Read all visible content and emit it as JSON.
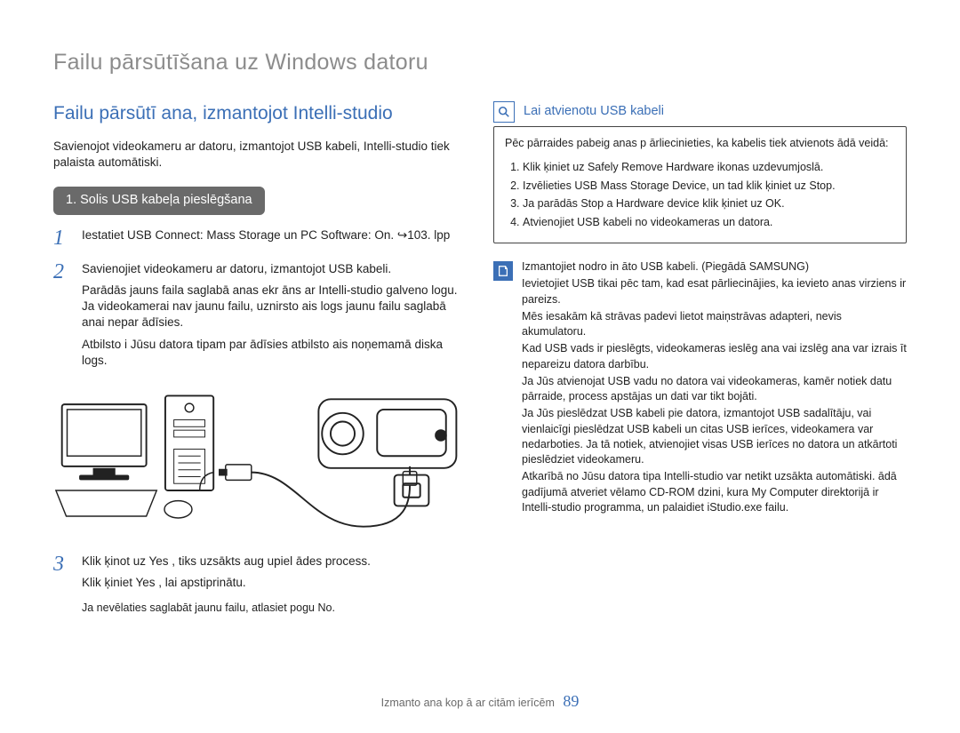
{
  "page_header": "Failu pārsūtīšana uz Windows datoru",
  "left": {
    "section_title": "Failu pārsūtī ana, izmantojot Intelli-studio",
    "intro": "Savienojot videokameru ar datoru, izmantojot USB kabeli, Intelli-studio tiek palaista automātiski.",
    "step_header": "1. Solis USB kabeļa pieslēgšana",
    "step1": {
      "num": "1",
      "text": "Iestatiet USB Connect: Mass Storage un PC Software: On. ↪103. lpp"
    },
    "step2": {
      "num": "2",
      "text": "Savienojiet videokameru ar datoru, izmantojot USB kabeli.",
      "sub1": "Parādās jauns faila saglabā anas ekr āns ar Intelli-studio galveno logu. Ja videokamerai nav jaunu failu, uznirsto ais logs jaunu failu saglabā anai nepar ādīsies.",
      "sub2": "Atbilsto i Jūsu datora tipam par ādīsies atbilsto ais noņemamā diska logs."
    },
    "step3": {
      "num": "3",
      "text1": "Klik ķinot uz  Yes , tiks uzsākts aug upiel ādes process.",
      "text2": "Klik ķiniet  Yes , lai apstiprinātu.",
      "sub": "Ja nevēlaties saglabāt jaunu failu, atlasiet pogu No."
    }
  },
  "right": {
    "callout_title": "Lai atvienotu USB kabeli",
    "callout_intro": "Pēc pārraides pabeig anas p ārliecinieties, ka kabelis tiek atvienots  ādā veidā:",
    "callout_list": [
      "Klik ķiniet uz  Safely Remove Hardware ikonas uzdevumjoslā.",
      "Izvēlieties USB Mass Storage Device, un tad klik  ķiniet uz Stop.",
      "Ja parādās Stop a Hardware device klik ķiniet uz  OK.",
      "Atvienojiet USB kabeli no videokameras un datora."
    ],
    "notes": [
      "Izmantojiet nodro in āto USB kabeli. (Piegādā SAMSUNG)",
      "Ievietojiet USB tikai pēc tam, kad esat pārliecinājies, ka ievieto anas virziens ir pareizs.",
      "Mēs iesakām kā strāvas padevi lietot maiņstrāvas adapteri, nevis akumulatoru.",
      "Kad USB vads ir pieslēgts, videokameras ieslēg ana vai izslēg ana var izrais īt nepareizu datora darbību.",
      "Ja Jūs atvienojat USB vadu no datora vai videokameras, kamēr notiek datu pārraide, process apstājas un dati var tikt bojāti.",
      "Ja Jūs pieslēdzat USB kabeli pie datora, izmantojot USB sadalītāju, vai vienlaicīgi pieslēdzat USB kabeli un citas USB ierīces, videokamera var nedarboties. Ja tā notiek, atvienojiet visas USB ierīces no datora un atkārtoti pieslēdziet videokameru.",
      "Atkarībā no Jūsu datora tipa Intelli-studio var netikt uzsākta automātiski.  ādā gadījumā atveriet vēlamo CD-ROM dzini, kura My Computer direktorijā ir Intelli-studio programma, un palaidiet iStudio.exe failu."
    ]
  },
  "footer": {
    "text": "Izmanto ana kop ā ar citām ierīcēm",
    "page": "89"
  },
  "icons": {
    "magnify": "magnify-icon",
    "note": "note-icon"
  }
}
